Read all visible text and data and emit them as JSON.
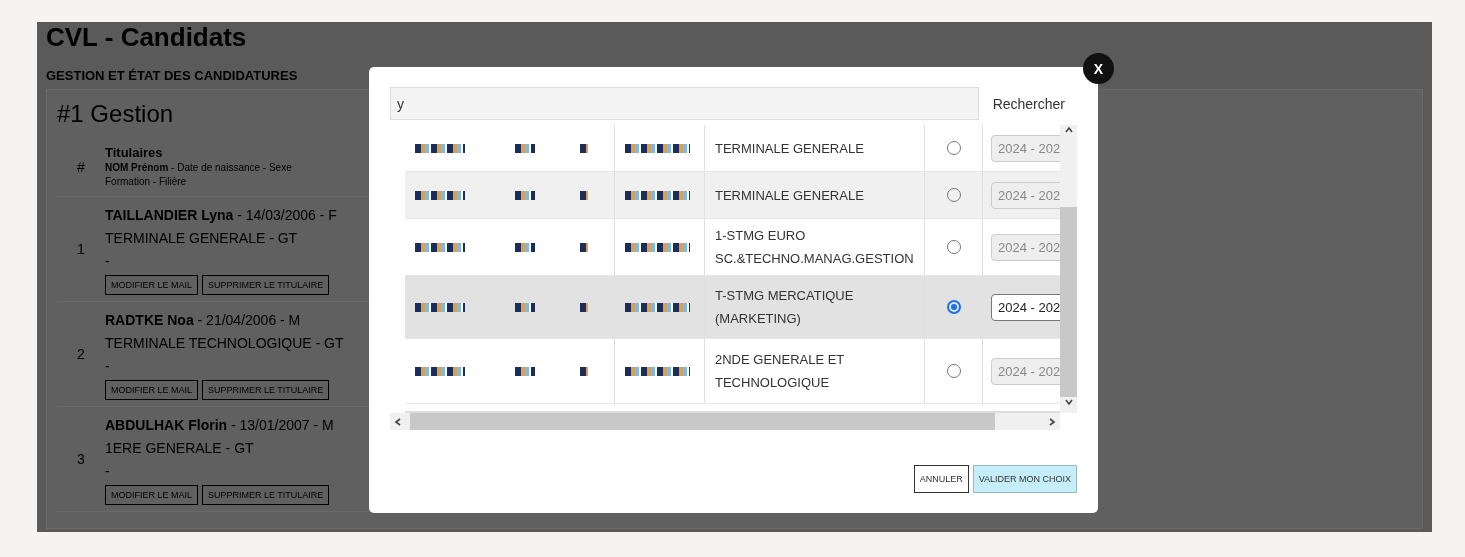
{
  "page": {
    "title": "CVL - Candidats",
    "section": "GESTION ET ÉTAT DES CANDIDATURES",
    "card_title": "#1 Gestion",
    "table": {
      "index_header": "#",
      "holders_header": "Titulaires",
      "holders_sub_bold": "NOM Prénom",
      "holders_sub": " - Date de naissance - Sexe",
      "holders_sub2": "Formation - Filière",
      "rows": [
        {
          "index": "1",
          "name": "TAILLANDIER Lyna",
          "details": " - 14/03/2006 - F",
          "program": "TERMINALE GENERALE - GT",
          "mail": "-",
          "buttons": [
            "MODIFIER LE MAIL",
            "SUPPRIMER LE TITULAIRE"
          ]
        },
        {
          "index": "2",
          "name": "RADTKE Noa",
          "details": " - 21/04/2006 - M",
          "program": "TERMINALE TECHNOLOGIQUE - GT",
          "mail": "-",
          "buttons": [
            "MODIFIER LE MAIL",
            "SUPPRIMER LE TITULAIRE"
          ]
        },
        {
          "index": "3",
          "name": "ABDULHAK Florin",
          "details": " - 13/01/2007 - M",
          "program": "1ERE GENERALE - GT",
          "mail": "-",
          "buttons": [
            "MODIFIER LE MAIL",
            "SUPPRIMER LE TITULAIRE"
          ]
        }
      ]
    }
  },
  "modal": {
    "close": "X",
    "search": {
      "value": "y"
    },
    "search_button": "Rechercher",
    "rows": [
      {
        "program": "TERMINALE GENERALE",
        "selected": false,
        "year": "2024 - 202",
        "year_disabled": true
      },
      {
        "program": "TERMINALE GENERALE",
        "selected": false,
        "year": "2024 - 202",
        "year_disabled": true
      },
      {
        "program": "1-STMG EURO SC.&TECHNO.MANAG.GESTION",
        "selected": false,
        "year": "2024 - 202",
        "year_disabled": true
      },
      {
        "program": "T-STMG MERCATIQUE (MARKETING)",
        "selected": true,
        "year": "2024 - 202",
        "year_disabled": false
      },
      {
        "program": "2NDE GENERALE ET TECHNOLOGIQUE",
        "selected": false,
        "year": "2024 - 202",
        "year_disabled": true
      }
    ],
    "buttons": [
      {
        "label": "ANNULER",
        "kind": "secondary"
      },
      {
        "label": "VALIDER MON CHOIX",
        "kind": "primary"
      }
    ]
  }
}
